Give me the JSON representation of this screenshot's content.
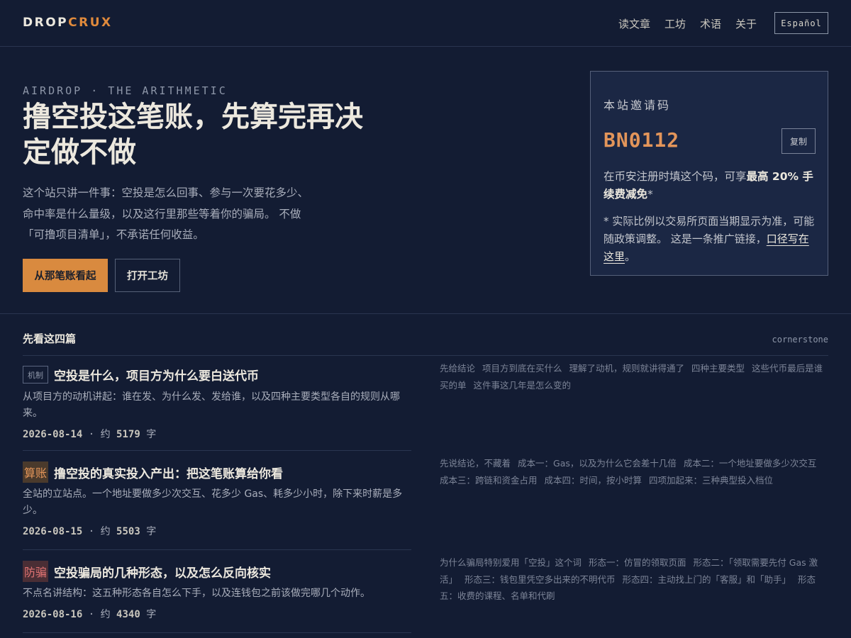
{
  "header": {
    "logo_a": "DROP",
    "logo_b": "CRUX",
    "nav": [
      "读文章",
      "工坊",
      "术语",
      "关于"
    ],
    "lang": "Español"
  },
  "hero": {
    "eyebrow": "AIRDROP · THE ARITHMETIC",
    "title": "撸空投这笔账，先算完再决定做不做",
    "desc": "这个站只讲一件事：空投是怎么回事、参与一次要花多少、 命中率是什么量级，以及这行里那些等着你的骗局。 不做「可撸项目清单」，不承诺任何收益。",
    "primary_btn": "从那笔账看起",
    "secondary_btn": "打开工坊"
  },
  "invite": {
    "label": "本站邀请码",
    "code": "BN0112",
    "copy": "复制",
    "text_pre": "在币安注册时填这个码，可享",
    "text_bold": "最高 20% 手续费减免",
    "text_post": "*",
    "note_pre": "* 实际比例以交易所页面当期显示为准，可能随政策调整。 这是一条推广链接，",
    "note_link": "口径写在这里",
    "note_post": "。"
  },
  "section": {
    "title": "先看这四篇",
    "tag": "cornerstone"
  },
  "articles": [
    {
      "badge": "机制",
      "title": "空投是什么，项目方为什么要白送代币",
      "desc": "从项目方的动机讲起：谁在发、为什么发、发给谁，以及四种主要类型各自的规则从哪来。",
      "date": "2026-08-14",
      "words_prefix": "约",
      "words": "5179",
      "words_suffix": "字",
      "toc": [
        "先给结论",
        "项目方到底在买什么",
        "理解了动机，规则就讲得通了",
        "四种主要类型",
        "这些代币最后是谁买的单",
        "这件事这几年是怎么变的"
      ]
    },
    {
      "badge": "算账",
      "title": "撸空投的真实投入产出：把这笔账算给你看",
      "desc": "全站的立站点。一个地址要做多少次交互、花多少 Gas、耗多少小时，除下来时薪是多少。",
      "date": "2026-08-15",
      "words_prefix": "约",
      "words": "5503",
      "words_suffix": "字",
      "toc": [
        "先说结论，不藏着",
        "成本一：Gas，以及为什么它会差十几倍",
        "成本二：一个地址要做多少次交互",
        "成本三：跨链和资金占用",
        "成本四：时间，按小时算",
        "四项加起来：三种典型投入档位"
      ]
    },
    {
      "badge": "防骗",
      "title": "空投骗局的几种形态，以及怎么反向核实",
      "desc": "不点名讲结构：这五种形态各自怎么下手，以及连钱包之前该做完哪几个动作。",
      "date": "2026-08-16",
      "words_prefix": "约",
      "words": "4340",
      "words_suffix": "字",
      "toc": [
        "为什么骗局特别爱用「空投」这个词",
        "形态一：仿冒的领取页面",
        "形态二：「领取需要先付 Gas 激活」",
        "形态三：钱包里凭空多出来的不明代币",
        "形态四：主动找上门的「客服」和「助手」",
        "形态五：收费的课程、名单和代刷"
      ]
    }
  ]
}
